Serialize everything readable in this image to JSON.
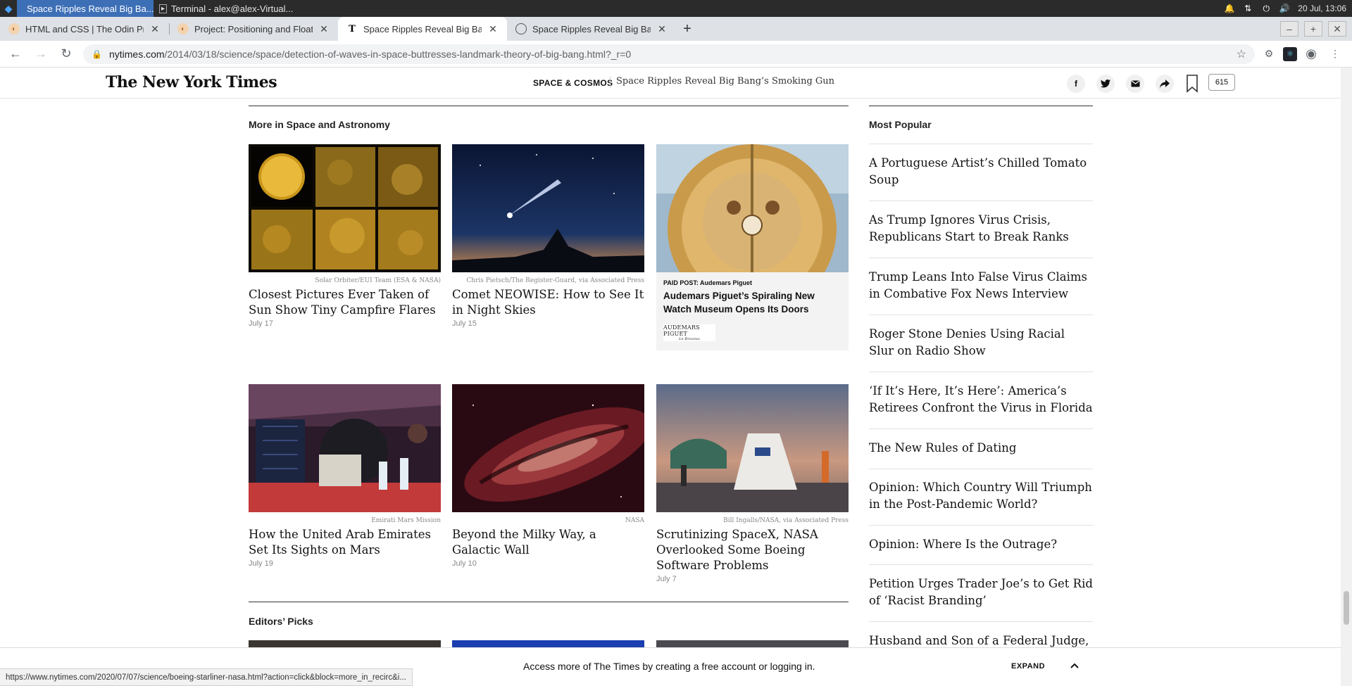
{
  "taskbar": {
    "windows": [
      {
        "label": "Space Ripples Reveal Big Ba..."
      },
      {
        "label": "Terminal - alex@alex-Virtual..."
      }
    ],
    "clock": "20 Jul, 13:06"
  },
  "browser": {
    "tabs": [
      {
        "label": "HTML and CSS | The Odin Proje",
        "icon": "odin-favicon"
      },
      {
        "label": "Project: Positioning and Floatin",
        "icon": "odin-favicon"
      },
      {
        "label": "Space Ripples Reveal Big Bang",
        "icon": "nyt-favicon"
      },
      {
        "label": "Space Ripples Reveal Big Bang",
        "icon": "globe-favicon"
      }
    ],
    "url_host": "nytimes.com",
    "url_path": "/2014/03/18/science/space/detection-of-waves-in-space-buttresses-landmark-theory-of-big-bang.html?_r=0"
  },
  "header": {
    "logo": "The New York Times",
    "section": "SPACE & COSMOS",
    "headline": "Space Ripples Reveal Big Bang’s Smoking Gun",
    "share_facebook": "f",
    "comment_count": "615"
  },
  "more": {
    "heading": "More in Space and Astronomy",
    "cards": [
      {
        "credit": "Solar Orbiter/EUI Team (ESA & NASA)",
        "title": "Closest Pictures Ever Taken of Sun Show Tiny Campfire Flares",
        "date": "July 17"
      },
      {
        "credit": "Chris Pietsch/The Register-Guard, via Associated Press",
        "title": "Comet NEOWISE: How to See It in Night Skies",
        "date": "July 15"
      },
      {
        "credit": "Emirati Mars Mission",
        "title": "How the United Arab Emirates Set Its Sights on Mars",
        "date": "July 19"
      },
      {
        "credit": "NASA",
        "title": "Beyond the Milky Way, a Galactic Wall",
        "date": "July 10"
      },
      {
        "credit": "Bill Ingalls/NASA, via Associated Press",
        "title": "Scrutinizing SpaceX, NASA Overlooked Some Boeing Software Problems",
        "date": "July 7"
      }
    ],
    "paid": {
      "label": "PAID POST: Audemars Piguet",
      "title": "Audemars Piguet’s Spiraling New Watch Museum Opens Its Doors",
      "logo_line1": "AUDEMARS PIGUET",
      "logo_line2": "Le Brassus"
    }
  },
  "editors": {
    "heading": "Editors’ Picks"
  },
  "popular": {
    "heading": "Most Popular",
    "items": [
      "A Portuguese Artist’s Chilled Tomato Soup",
      "As Trump Ignores Virus Crisis, Republicans Start to Break Ranks",
      "Trump Leans Into False Virus Claims in Combative Fox News Interview",
      "Roger Stone Denies Using Racial Slur on Radio Show",
      "‘If It’s Here, It’s Here’: America’s Retirees Confront the Virus in Florida",
      "The New Rules of Dating",
      "Opinion: Which Country Will Triumph in the Post-Pandemic World?",
      "Opinion: Where Is the Outrage?",
      "Petition Urges Trader Joe’s to Get Rid of ‘Racist Branding’",
      "Husband and Son of a Federal Judge,"
    ]
  },
  "bottom": {
    "message": "Access more of The Times by creating a free account or logging in.",
    "expand": "EXPAND"
  },
  "status_url": "https://www.nytimes.com/2020/07/07/science/boeing-starliner-nasa.html?action=click&block=more_in_recirc&i..."
}
